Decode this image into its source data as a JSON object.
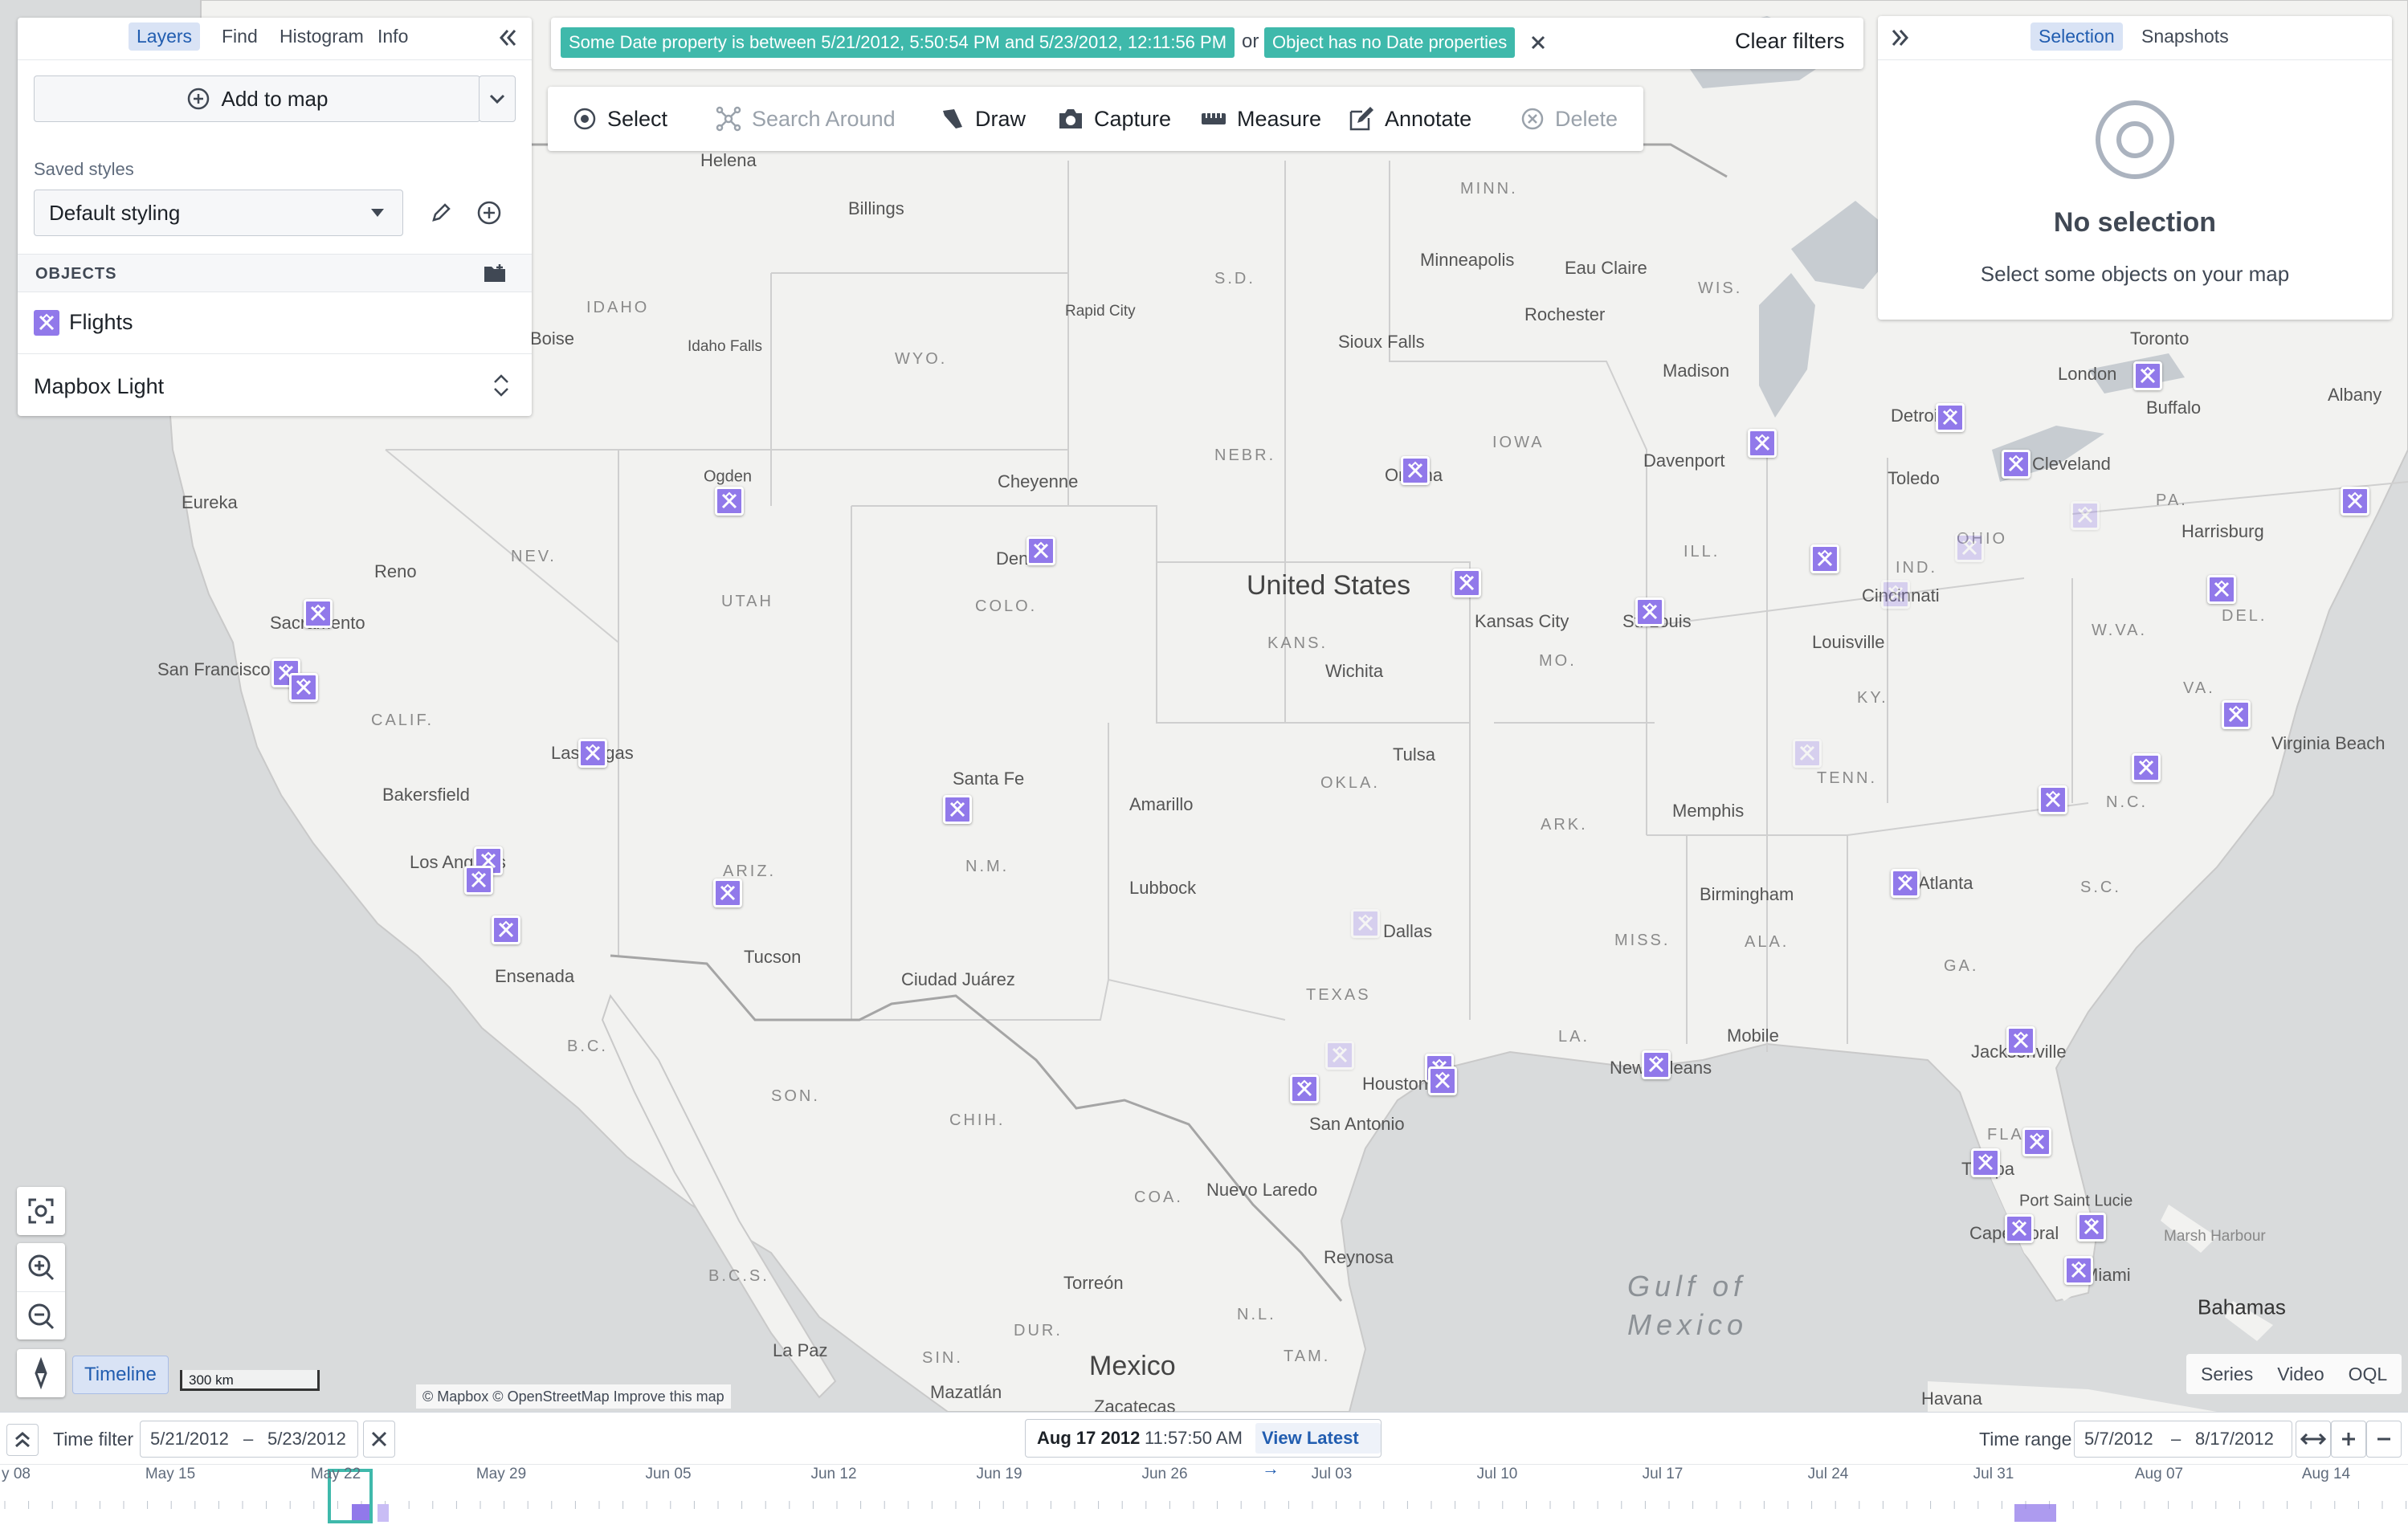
{
  "left_panel": {
    "tabs": [
      "Layers",
      "Find",
      "Histogram",
      "Info"
    ],
    "active_tab": "Layers",
    "add_to_map_label": "Add to map",
    "saved_styles_label": "Saved styles",
    "style_select_value": "Default styling",
    "objects_header": "OBJECTS",
    "layer_name": "Flights",
    "basemap_name": "Mapbox Light"
  },
  "filter_bar": {
    "chip_1": "Some Date property is between 5/21/2012, 5:50:54 PM and 5/23/2012, 12:11:56 PM",
    "joiner": "or",
    "chip_2": "Object has no Date properties",
    "clear_label": "Clear filters"
  },
  "toolbar": {
    "select": "Select",
    "search_around": "Search Around",
    "draw": "Draw",
    "capture": "Capture",
    "measure": "Measure",
    "annotate": "Annotate",
    "delete": "Delete"
  },
  "right_panel": {
    "tabs": [
      "Selection",
      "Snapshots"
    ],
    "active_tab": "Selection",
    "empty_title": "No selection",
    "empty_subtitle": "Select some objects on your map"
  },
  "map": {
    "country_label": "United States",
    "mexico_label": "Mexico",
    "gulf_label_1": "Gulf of",
    "gulf_label_2": "Mexico",
    "bahamas_label": "Bahamas",
    "cities": [
      "Helena",
      "Billings",
      "Minneapolis",
      "Eau Claire",
      "Rochester",
      "Boise",
      "Idaho Falls",
      "Rapid City",
      "Sioux Falls",
      "Madison",
      "Toronto",
      "London",
      "Buffalo",
      "Albany",
      "Detroit",
      "Toledo",
      "Cleveland",
      "Ogden",
      "Cheyenne",
      "Omaha",
      "Davenport",
      "Reno",
      "Eureka",
      "Sacramento",
      "San Francisco",
      "Denver",
      "Kansas City",
      "St. Louis",
      "Cincinnati",
      "Harrisburg",
      "Wichita",
      "Louisville",
      "Las Vegas",
      "Bakersfield",
      "Santa Fe",
      "Amarillo",
      "Tulsa",
      "Memphis",
      "Virginia Beach",
      "Los Angeles",
      "Lubbock",
      "Birmingham",
      "Atlanta",
      "Ensenada",
      "Tucson",
      "Ciudad Juárez",
      "Dallas",
      "Mobile",
      "New Orleans",
      "Jacksonville",
      "Houston",
      "San Antonio",
      "Tampa",
      "Port Saint Lucie",
      "Cape Coral",
      "Miami",
      "Nuevo Laredo",
      "Reynosa",
      "Torreón",
      "La Paz",
      "Mazatlán",
      "Havana",
      "Marsh Harbour",
      "Zacatecas"
    ],
    "states": [
      "MINN.",
      "S.D.",
      "WIS.",
      "IDAHO",
      "WYO.",
      "NEBR.",
      "IOWA",
      "NEV.",
      "UTAH",
      "COLO.",
      "KANS.",
      "MO.",
      "ILL.",
      "OHIO",
      "PA.",
      "IND.",
      "W.VA.",
      "DEL.",
      "VA.",
      "KY.",
      "CALIF.",
      "OKLA.",
      "TENN.",
      "N.C.",
      "ARK.",
      "ARIZ.",
      "N.M.",
      "TEXAS",
      "MISS.",
      "ALA.",
      "GA.",
      "S.C.",
      "LA.",
      "FLA.",
      "B.C.",
      "SON.",
      "CHIH.",
      "COA.",
      "N.L.",
      "B.C.S.",
      "DUR.",
      "SIN.",
      "TAM."
    ],
    "attribution": "© Mapbox © OpenStreetMap Improve this map",
    "scale_label": "300 km",
    "timeline_button": "Timeline",
    "bottom_tabs": [
      "Series",
      "Video",
      "OQL"
    ]
  },
  "timeline": {
    "time_filter_label": "Time filter",
    "filter_start": "5/21/2012",
    "filter_end": "5/23/2012",
    "current_date": "Aug 17 2012",
    "current_time": "11:57:50 AM",
    "view_latest": "View Latest →",
    "time_range_label": "Time range",
    "range_start": "5/7/2012",
    "range_end": "8/17/2012",
    "dash": "–",
    "ticks": [
      "y 08",
      "May 15",
      "May 22",
      "May 29",
      "Jun 05",
      "Jun 12",
      "Jun 19",
      "Jun 26",
      "Jul 03",
      "Jul 10",
      "Jul 17",
      "Jul 24",
      "Jul 31",
      "Aug 07",
      "Aug 14"
    ]
  },
  "colors": {
    "marker": "#9179ea",
    "chip": "#3fb9ab",
    "accent": "#215db0"
  }
}
